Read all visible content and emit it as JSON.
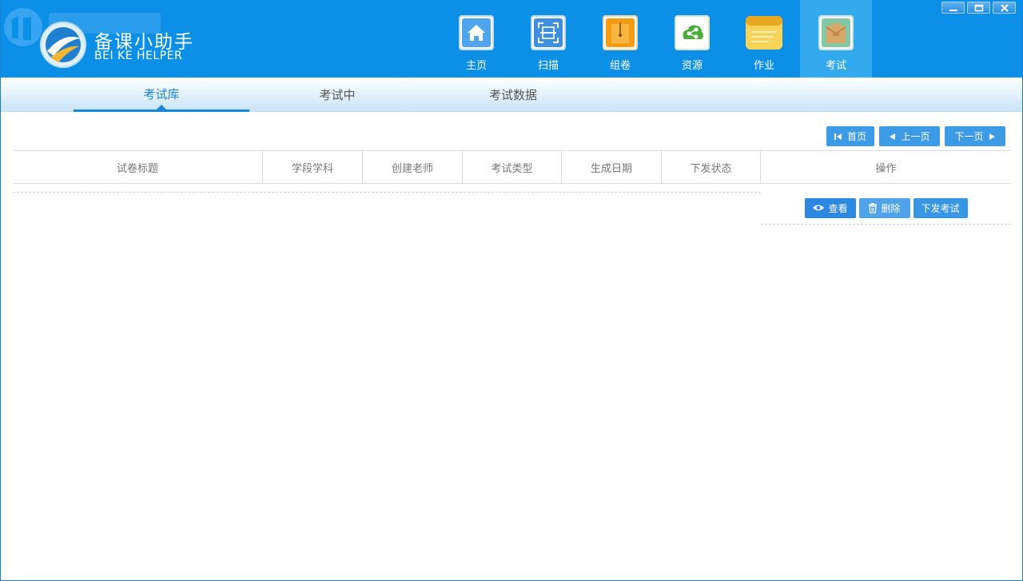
{
  "app": {
    "name_cn": "备课小助手",
    "name_en": "BEI KE HELPER",
    "accent": "#0c8fe7"
  },
  "nav": [
    {
      "label": "主页",
      "icon": "home-icon",
      "color": "#5aaaf0"
    },
    {
      "label": "扫描",
      "icon": "scan-icon",
      "color": "#4a97e6"
    },
    {
      "label": "组卷",
      "icon": "folder-icon",
      "color": "#f39c12"
    },
    {
      "label": "资源",
      "icon": "share-icon",
      "color": "#4cae3a"
    },
    {
      "label": "作业",
      "icon": "notepad-icon",
      "color": "#f3c22e"
    },
    {
      "label": "考试",
      "icon": "envelope-icon",
      "color": "#7cc09a"
    }
  ],
  "window_controls": [
    "minimize-icon",
    "maximize-icon",
    "close-icon"
  ],
  "subtabs": [
    {
      "label": "考试库"
    },
    {
      "label": "考试中"
    },
    {
      "label": "考试数据"
    }
  ],
  "pager": {
    "first": "首页",
    "prev": "上一页",
    "next": "下一页"
  },
  "table": {
    "columns": [
      "试卷标题",
      "学段学科",
      "创建老师",
      "考试类型",
      "生成日期",
      "下发状态",
      "操作"
    ]
  },
  "row_actions": {
    "view": "查看",
    "delete": "删除",
    "send": "下发考试"
  }
}
